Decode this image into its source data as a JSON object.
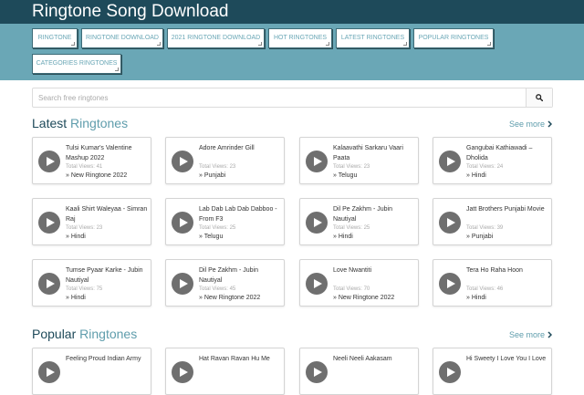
{
  "site": {
    "title": "Ringtone Song Download"
  },
  "nav": [
    "RINGTONE",
    "RINGTONE DOWNLOAD",
    "2021 RINGTONE DOWNLOAD",
    "HOT RINGTONES",
    "LATEST RINGTONES",
    "POPULAR RINGTONES",
    "CATEGORIES RINGTONES"
  ],
  "search": {
    "placeholder": "Search free ringtones",
    "icon": "search-icon"
  },
  "latest": {
    "title_bold": "Latest",
    "title_light": " Ringtones",
    "see_more": "See more",
    "items": [
      {
        "title": "Tulsi Kumar's Valentine Mashup 2022",
        "views": "Total Views: 41",
        "category": "» New Ringtone 2022"
      },
      {
        "title": "Adore Amrinder Gill",
        "views": "Total Views: 23",
        "category": "» Punjabi"
      },
      {
        "title": "Kalaavathi Sarkaru Vaari Paata",
        "views": "Total Views: 23",
        "category": "» Telugu"
      },
      {
        "title": "Gangubai Kathiawadi – Dholida",
        "views": "Total Views: 24",
        "category": "» Hindi"
      },
      {
        "title": "Kaali Shirt Waleyaa - Simran Raj",
        "views": "Total Views: 23",
        "category": "» Hindi"
      },
      {
        "title": "Lab Dab Lab Dab Dabboo - From F3",
        "views": "Total Views: 25",
        "category": "» Telugu"
      },
      {
        "title": "Dil Pe Zakhm - Jubin Nautiyal",
        "views": "Total Views: 25",
        "category": "» Hindi"
      },
      {
        "title": "Jatt Brothers Punjabi Movie",
        "views": "Total Views: 39",
        "category": "» Punjabi"
      },
      {
        "title": "Tumse Pyaar Karke - Jubin Nautiyal",
        "views": "Total Views: 75",
        "category": "» Hindi"
      },
      {
        "title": "Dil Pe Zakhm - Jubin Nautiyal",
        "views": "Total Views: 45",
        "category": "» New Ringtone 2022"
      },
      {
        "title": "Love Nwantiti",
        "views": "Total Views: 70",
        "category": "» New Ringtone 2022"
      },
      {
        "title": "Tera Ho Raha Hoon",
        "views": "Total Views: 46",
        "category": "» Hindi"
      }
    ]
  },
  "popular": {
    "title_bold": "Popular",
    "title_light": " Ringtones",
    "see_more": "See more",
    "items": [
      {
        "title": "Feeling Proud Indian Army"
      },
      {
        "title": "Hat Ravan Ravan Hu Me"
      },
      {
        "title": "Neeli Neeli Aakasam"
      },
      {
        "title": "Hi Sweety I Love You I Love"
      }
    ]
  }
}
